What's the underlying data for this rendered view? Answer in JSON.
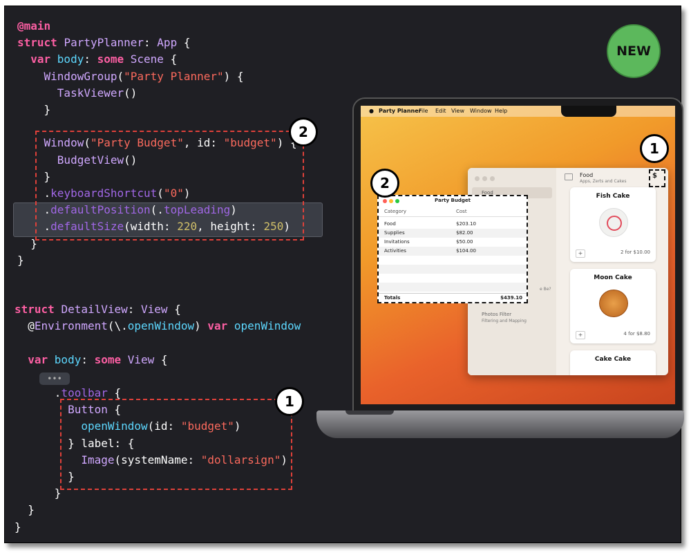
{
  "code_lines": [
    {
      "parts": [
        {
          "c": "kw",
          "t": "@main"
        }
      ]
    },
    {
      "parts": [
        {
          "c": "kw",
          "t": "struct "
        },
        {
          "c": "ty",
          "t": "PartyPlanner"
        },
        {
          "c": "",
          "t": ": "
        },
        {
          "c": "ty",
          "t": "App"
        },
        {
          "c": "",
          "t": " {"
        }
      ]
    },
    {
      "parts": [
        {
          "c": "",
          "t": "  "
        },
        {
          "c": "kw",
          "t": "var "
        },
        {
          "c": "ty2",
          "t": "body"
        },
        {
          "c": "",
          "t": ": "
        },
        {
          "c": "kw",
          "t": "some "
        },
        {
          "c": "ty",
          "t": "Scene"
        },
        {
          "c": "",
          "t": " {"
        }
      ]
    },
    {
      "parts": [
        {
          "c": "",
          "t": "    "
        },
        {
          "c": "ty",
          "t": "WindowGroup"
        },
        {
          "c": "",
          "t": "("
        },
        {
          "c": "str",
          "t": "\"Party Planner\""
        },
        {
          "c": "",
          "t": ") {"
        }
      ]
    },
    {
      "parts": [
        {
          "c": "",
          "t": "      "
        },
        {
          "c": "ty",
          "t": "TaskViewer"
        },
        {
          "c": "",
          "t": "()"
        }
      ]
    },
    {
      "parts": [
        {
          "c": "",
          "t": "    }"
        }
      ]
    },
    {
      "parts": [
        {
          "c": "",
          "t": ""
        }
      ]
    },
    {
      "parts": [
        {
          "c": "",
          "t": "    "
        },
        {
          "c": "ty",
          "t": "Window"
        },
        {
          "c": "",
          "t": "("
        },
        {
          "c": "str",
          "t": "\"Party Budget\""
        },
        {
          "c": "",
          "t": ", id: "
        },
        {
          "c": "str",
          "t": "\"budget\""
        },
        {
          "c": "",
          "t": ") {"
        }
      ]
    },
    {
      "parts": [
        {
          "c": "",
          "t": "      "
        },
        {
          "c": "ty",
          "t": "BudgetView"
        },
        {
          "c": "",
          "t": "()"
        }
      ]
    },
    {
      "parts": [
        {
          "c": "",
          "t": "    }"
        }
      ]
    },
    {
      "parts": [
        {
          "c": "",
          "t": "    ."
        },
        {
          "c": "fn",
          "t": "keyboardShortcut"
        },
        {
          "c": "",
          "t": "("
        },
        {
          "c": "str",
          "t": "\"0\""
        },
        {
          "c": "",
          "t": ")"
        }
      ]
    },
    {
      "parts": [
        {
          "c": "",
          "t": "    ."
        },
        {
          "c": "fn",
          "t": "defaultPosition"
        },
        {
          "c": "",
          "t": "(."
        },
        {
          "c": "fn",
          "t": "topLeading"
        },
        {
          "c": "",
          "t": ")"
        }
      ]
    },
    {
      "parts": [
        {
          "c": "",
          "t": "    ."
        },
        {
          "c": "fn",
          "t": "defaultSize"
        },
        {
          "c": "",
          "t": "(width: "
        },
        {
          "c": "num",
          "t": "220"
        },
        {
          "c": "",
          "t": ", height: "
        },
        {
          "c": "num",
          "t": "250"
        },
        {
          "c": "",
          "t": ")"
        }
      ]
    },
    {
      "parts": [
        {
          "c": "",
          "t": "  }"
        }
      ]
    },
    {
      "parts": [
        {
          "c": "",
          "t": "}"
        }
      ]
    }
  ],
  "code_lines_b": [
    {
      "parts": [
        {
          "c": "kw",
          "t": "struct "
        },
        {
          "c": "ty",
          "t": "DetailView"
        },
        {
          "c": "",
          "t": ": "
        },
        {
          "c": "ty",
          "t": "View"
        },
        {
          "c": "",
          "t": " {"
        }
      ]
    },
    {
      "parts": [
        {
          "c": "",
          "t": "  @"
        },
        {
          "c": "ty",
          "t": "Environment"
        },
        {
          "c": "",
          "t": "(\\."
        },
        {
          "c": "ty2",
          "t": "openWindow"
        },
        {
          "c": "",
          "t": ") "
        },
        {
          "c": "kw",
          "t": "var "
        },
        {
          "c": "ty2",
          "t": "openWindow"
        }
      ]
    },
    {
      "parts": [
        {
          "c": "",
          "t": ""
        }
      ]
    },
    {
      "parts": [
        {
          "c": "",
          "t": "  "
        },
        {
          "c": "kw",
          "t": "var "
        },
        {
          "c": "ty2",
          "t": "body"
        },
        {
          "c": "",
          "t": ": "
        },
        {
          "c": "kw",
          "t": "some "
        },
        {
          "c": "ty",
          "t": "View"
        },
        {
          "c": "",
          "t": " {"
        }
      ]
    },
    {
      "parts": [
        {
          "c": "",
          "t": ""
        }
      ]
    },
    {
      "parts": [
        {
          "c": "",
          "t": "      ."
        },
        {
          "c": "fn",
          "t": "toolbar"
        },
        {
          "c": "",
          "t": " {"
        }
      ]
    },
    {
      "parts": [
        {
          "c": "",
          "t": "        "
        },
        {
          "c": "ty",
          "t": "Button"
        },
        {
          "c": "",
          "t": " {"
        }
      ]
    },
    {
      "parts": [
        {
          "c": "",
          "t": "          "
        },
        {
          "c": "ty2",
          "t": "openWindow"
        },
        {
          "c": "",
          "t": "(id: "
        },
        {
          "c": "str",
          "t": "\"budget\""
        },
        {
          "c": "",
          "t": ")"
        }
      ]
    },
    {
      "parts": [
        {
          "c": "",
          "t": "        } label: {"
        }
      ]
    },
    {
      "parts": [
        {
          "c": "",
          "t": "          "
        },
        {
          "c": "ty",
          "t": "Image"
        },
        {
          "c": "",
          "t": "(systemName: "
        },
        {
          "c": "str",
          "t": "\"dollarsign\""
        },
        {
          "c": "",
          "t": ")"
        }
      ]
    },
    {
      "parts": [
        {
          "c": "",
          "t": "        }"
        }
      ]
    },
    {
      "parts": [
        {
          "c": "",
          "t": "      }"
        }
      ]
    },
    {
      "parts": [
        {
          "c": "",
          "t": "  }"
        }
      ]
    },
    {
      "parts": [
        {
          "c": "",
          "t": "}"
        }
      ]
    }
  ],
  "badges": {
    "one": "1",
    "two": "2",
    "new": "NEW",
    "ellipsis": "•••"
  },
  "menubar": {
    "apple": "",
    "app": "Party Planner",
    "file": "File",
    "edit": "Edit",
    "view": "View",
    "window": "Window",
    "help": "Help"
  },
  "app": {
    "sidebar_selected": "Food",
    "header_title": "Food",
    "header_subtitle": "Apps, Zerts and Cakes",
    "dollar_icon": "$",
    "sidebar_extra_1": "e Be?",
    "sidebar_extra_2": "Photos Filter",
    "sidebar_extra_3": "Filtering and Mapping",
    "cards": [
      {
        "title": "Fish Cake",
        "price": "2 for $10.00"
      },
      {
        "title": "Moon Cake",
        "price": "4 for $8.80"
      },
      {
        "title": "Cake Cake",
        "price": ""
      }
    ]
  },
  "budget": {
    "title": "Party Budget",
    "col_category": "Category",
    "col_cost": "Cost",
    "rows": [
      {
        "category": "Food",
        "cost": "$203.10"
      },
      {
        "category": "Supplies",
        "cost": "$82.00"
      },
      {
        "category": "Invitations",
        "cost": "$50.00"
      },
      {
        "category": "Activities",
        "cost": "$104.00"
      }
    ],
    "totals_label": "Totals",
    "totals_value": "$439.10"
  }
}
